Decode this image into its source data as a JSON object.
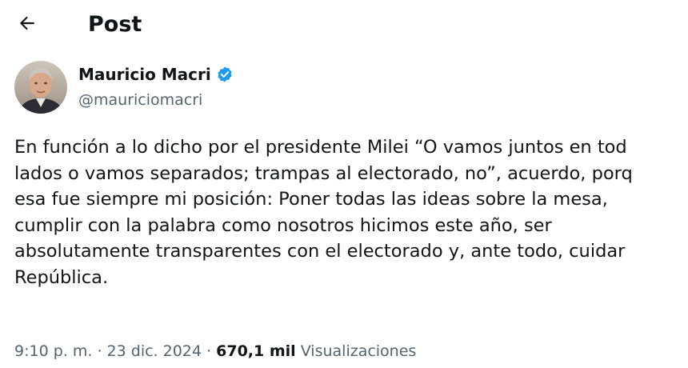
{
  "header": {
    "title": "Post",
    "back_icon": "arrow-left-icon"
  },
  "author": {
    "display_name": "Mauricio Macri",
    "handle": "@mauriciomacri",
    "verified_icon": "verified-badge-icon",
    "verified_color": "#1d9bf0"
  },
  "post": {
    "lines": [
      "En función a lo dicho por el presidente Milei “O vamos juntos en tod",
      "lados o vamos separados; trampas al electorado, no”, acuerdo, porq",
      "esa fue siempre mi posición: Poner todas las ideas sobre la mesa,",
      "cumplir con la palabra como nosotros hicimos este año, ser",
      "absolutamente transparentes con el electorado y, ante todo, cuidar",
      "República."
    ]
  },
  "meta": {
    "time": "9:10 p. m.",
    "separator": "·",
    "date": "23 dic. 2024",
    "views_count": "670,1 mil",
    "views_label": "Visualizaciones"
  }
}
